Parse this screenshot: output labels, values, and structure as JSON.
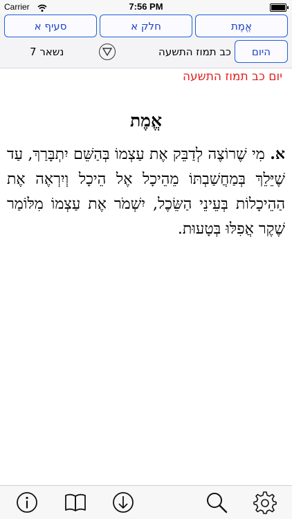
{
  "status": {
    "carrier": "Carrier",
    "time": "7:56 PM"
  },
  "nav": {
    "segments": [
      "סעיף א",
      "חלק א",
      "אֱמֶת"
    ],
    "remaining": "נשאר 7",
    "date": "כב תמוז התשעה",
    "today": "היום"
  },
  "content": {
    "date_title": "יום כב תמוז התשעה",
    "heading": "אֱמֶת",
    "marker": "א.",
    "text": "מִי שֶׁרוֹצֶה לְדַבֵּק אֶת עַצְמוֹ בְּהַשֵּׁם יִתְבָּרַךְ, עַד שֶׁיֵּלֵךְ בְּמַחֲשַׁבְתּוֹ מֵהֵיכָל אֶל הֵיכָל וְיִרְאֶה אֶת הַהֵיכָלוֹת בְּעֵינֵי הַשֵּׂכֶל, יִשְׁמֹר אֶת עַצְמוֹ מִלּוֹמַר שֶׁקֶר אֲפִלּוּ בְּטָעוּת."
  },
  "toolbar": {
    "icons": [
      "info-icon",
      "book-icon",
      "download-icon",
      "search-icon",
      "gear-icon"
    ]
  }
}
